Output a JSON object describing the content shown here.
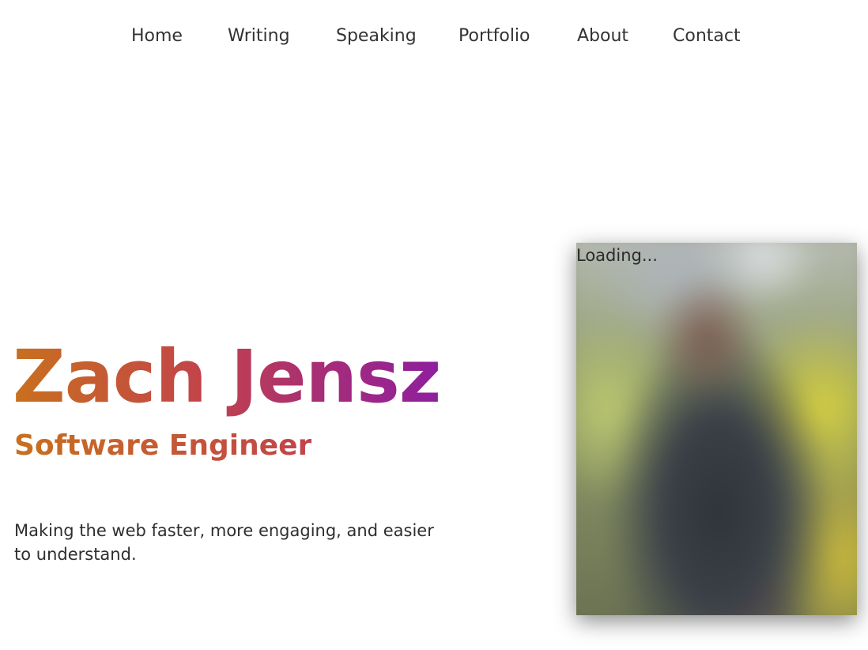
{
  "nav": {
    "items": [
      {
        "label": "Home"
      },
      {
        "label": "Writing"
      },
      {
        "label": "Speaking"
      },
      {
        "label": "Portfolio"
      },
      {
        "label": "About"
      },
      {
        "label": "Contact"
      }
    ]
  },
  "hero": {
    "name": "Zach Jensz",
    "role": "Software Engineer",
    "tagline": "Making the web faster, more engaging, and easier to understand."
  },
  "photo": {
    "loading_text": "Loading..."
  },
  "colors": {
    "gradient_start": "#c8701e",
    "gradient_mid": "#c2434a",
    "gradient_end": "#8e1f9e"
  }
}
